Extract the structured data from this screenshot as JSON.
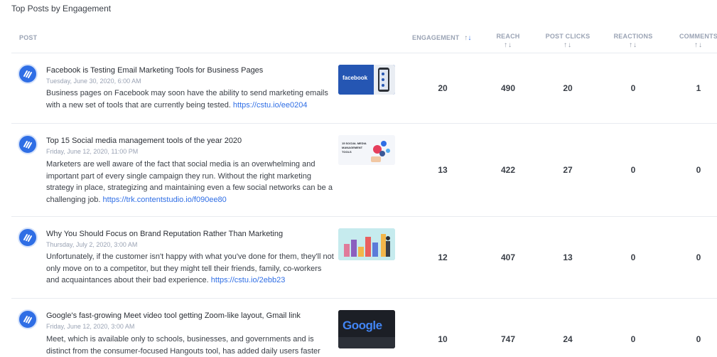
{
  "title": "Top Posts by Engagement",
  "headers": {
    "post": "POST",
    "engagement": "ENGAGEMENT",
    "reach": "REACH",
    "post_clicks": "POST CLICKS",
    "reactions": "REACTIONS",
    "comments": "COMMENTS",
    "sort_arrows": "⇅"
  },
  "colors": {
    "accent": "#2f6ee5",
    "muted": "#9aa3b4"
  },
  "icons": {
    "avatar": "contentstudio-logo-icon",
    "sort": "sort-arrows-icon"
  },
  "posts": [
    {
      "title": "Facebook is Testing Email Marketing Tools for Business Pages",
      "date": "Tuesday, June 30, 2020, 6:00 AM",
      "body": "Business pages on Facebook may soon have the ability to send marketing emails with a new set of tools that are currently being tested. ",
      "link": "https://cstu.io/ee0204",
      "thumb_text": "facebook",
      "engagement": "20",
      "reach": "490",
      "post_clicks": "20",
      "reactions": "0",
      "comments": "1"
    },
    {
      "title": "Top 15 Social media management tools of the year 2020",
      "date": "Friday, June 12, 2020, 11:00 PM",
      "body": "Marketers are well aware of the fact that social media is an overwhelming and important part of every single campaign they run. Without the right marketing strategy in place, strategizing and maintaining even a few social networks can be a challenging job. ",
      "link": "https://trk.contentstudio.io/f090ee80",
      "thumb_text": "15 SOCIAL MEDIA MANAGEMENT TOOLS",
      "engagement": "13",
      "reach": "422",
      "post_clicks": "27",
      "reactions": "0",
      "comments": "0"
    },
    {
      "title": "Why You Should Focus on Brand Reputation Rather Than Marketing",
      "date": "Thursday, July 2, 2020, 3:00 AM",
      "body": "Unfortunately, if the customer isn't happy with what you've done for them, they'll not only move on to a competitor, but they might tell their friends, family, co-workers and acquaintances about their bad experience. ",
      "link": "https://cstu.io/2ebb23",
      "thumb_text": "",
      "engagement": "12",
      "reach": "407",
      "post_clicks": "13",
      "reactions": "0",
      "comments": "0"
    },
    {
      "title": "Google's fast-growing Meet video tool getting Zoom-like layout, Gmail link",
      "date": "Friday, June 12, 2020, 3:00 AM",
      "body": "Meet, which is available only to schools, businesses, and governments and is distinct from the consumer-focused Hangouts tool, has added daily users faster",
      "link": "",
      "thumb_text": "Google",
      "engagement": "10",
      "reach": "747",
      "post_clicks": "24",
      "reactions": "0",
      "comments": "0"
    }
  ]
}
